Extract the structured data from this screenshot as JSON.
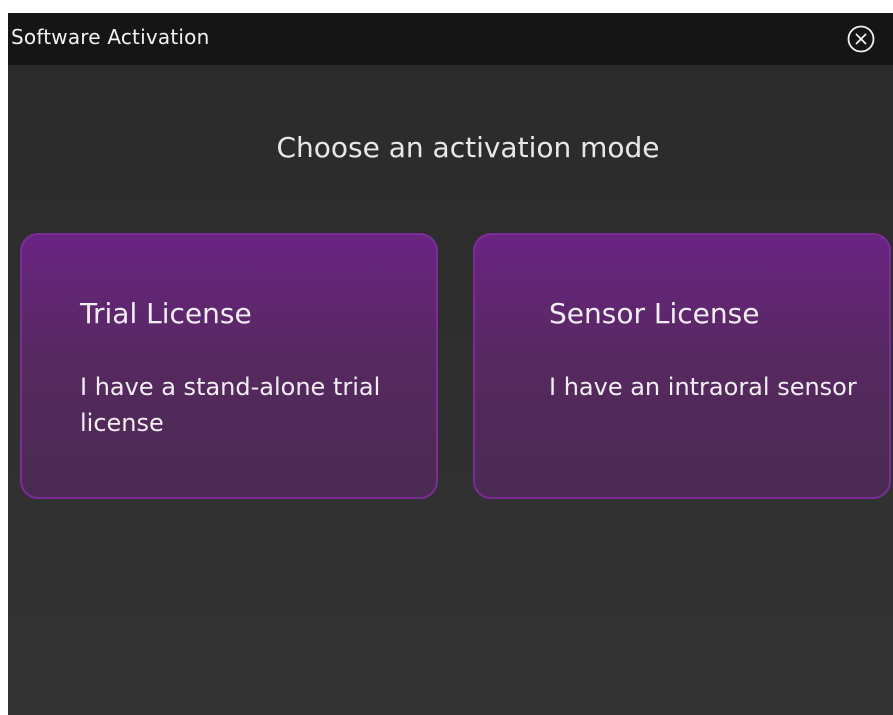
{
  "window": {
    "title": "Software Activation"
  },
  "heading": "Choose an activation mode",
  "options": [
    {
      "title": "Trial License",
      "description": "I have a stand-alone trial license"
    },
    {
      "title": "Sensor License",
      "description": "I have an intraoral sensor"
    }
  ],
  "colors": {
    "titlebar": "#151515",
    "background": "#2e2e2e",
    "card_top": "#6a2483",
    "card_bottom": "#4a2a52",
    "card_border": "#7b2d96",
    "text": "#f2f2f2"
  },
  "icons": {
    "close": "close-circle-icon"
  }
}
